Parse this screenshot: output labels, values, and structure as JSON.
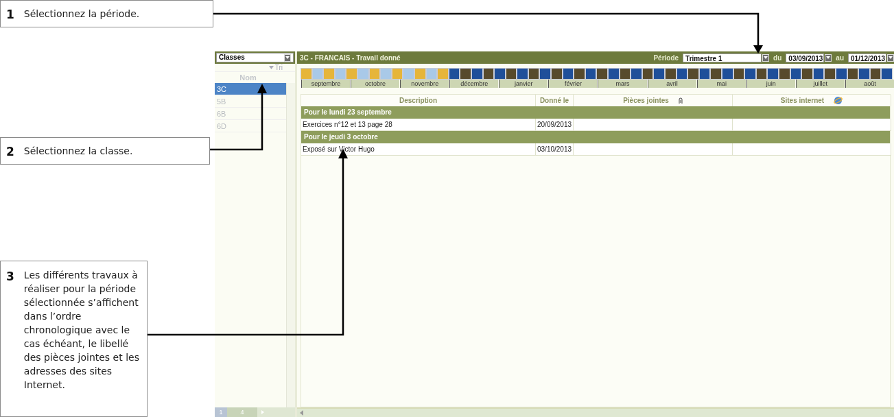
{
  "callouts": [
    {
      "number": "1",
      "text": "Sélectionnez la période."
    },
    {
      "number": "2",
      "text": "Sélectionnez la classe."
    },
    {
      "number": "3",
      "text": "Les différents travaux à réaliser pour la période sélectionnée s’affichent dans l’ordre chronologique avec le cas échéant, le libellé des pièces jointes et les adresses des sites Internet."
    }
  ],
  "sidebar": {
    "selector": "Classes",
    "sort_label": "Tri",
    "column": "Nom",
    "items": [
      {
        "label": "3C",
        "selected": true
      },
      {
        "label": "5B",
        "selected": false
      },
      {
        "label": "6B",
        "selected": false
      },
      {
        "label": "6D",
        "selected": false
      }
    ],
    "pager": {
      "current": "1",
      "total": "4"
    }
  },
  "header": {
    "title": "3C - FRANCAIS - Travail donné",
    "period_label": "Période",
    "period": "Trimestre 1",
    "from_label": "du",
    "from": "03/09/2013",
    "to_label": "au",
    "to": "01/12/2013"
  },
  "timeline": {
    "weeks": [
      {
        "color": "#e6b53a"
      },
      {
        "color": "#a9c9e8"
      },
      {
        "color": "#e6b53a"
      },
      {
        "color": "#a9c9e8"
      },
      {
        "color": "#e6b53a"
      },
      {
        "color": "#a9c9e8"
      },
      {
        "color": "#e6b53a"
      },
      {
        "color": "#a9c9e8"
      },
      {
        "color": "#e6b53a"
      },
      {
        "color": "#a9c9e8"
      },
      {
        "color": "#e6b53a"
      },
      {
        "color": "#a9c9e8"
      },
      {
        "color": "#e6b53a"
      },
      {
        "color": "#1f4f9a"
      },
      {
        "color": "#574a2c"
      },
      {
        "color": "#1f4f9a"
      },
      {
        "color": "#574a2c"
      },
      {
        "color": "#1f4f9a"
      },
      {
        "color": "#574a2c"
      },
      {
        "color": "#1f4f9a"
      },
      {
        "color": "#574a2c"
      },
      {
        "color": "#1f4f9a"
      },
      {
        "color": "#574a2c"
      },
      {
        "color": "#1f4f9a"
      },
      {
        "color": "#574a2c"
      },
      {
        "color": "#1f4f9a"
      },
      {
        "color": "#574a2c"
      },
      {
        "color": "#1f4f9a"
      },
      {
        "color": "#574a2c"
      },
      {
        "color": "#1f4f9a"
      },
      {
        "color": "#574a2c"
      },
      {
        "color": "#1f4f9a"
      },
      {
        "color": "#574a2c"
      },
      {
        "color": "#1f4f9a"
      },
      {
        "color": "#574a2c"
      },
      {
        "color": "#1f4f9a"
      },
      {
        "color": "#574a2c"
      },
      {
        "color": "#1f4f9a"
      },
      {
        "color": "#574a2c"
      },
      {
        "color": "#1f4f9a"
      },
      {
        "color": "#574a2c"
      },
      {
        "color": "#1f4f9a"
      },
      {
        "color": "#574a2c"
      },
      {
        "color": "#1f4f9a"
      },
      {
        "color": "#574a2c"
      },
      {
        "color": "#1f4f9a"
      },
      {
        "color": "#574a2c"
      },
      {
        "color": "#1f4f9a"
      },
      {
        "color": "#574a2c"
      },
      {
        "color": "#1f4f9a"
      },
      {
        "color": "#574a2c"
      },
      {
        "color": "#1f4f9a"
      }
    ],
    "months": [
      "septembre",
      "octobre",
      "novembre",
      "décembre",
      "janvier",
      "février",
      "mars",
      "avril",
      "mai",
      "juin",
      "juillet",
      "août"
    ]
  },
  "table": {
    "columns": [
      "Description",
      "Donné le",
      "Pièces jointes",
      "Sites internet"
    ],
    "groups": [
      {
        "title": "Pour le lundi 23 septembre",
        "rows": [
          {
            "description": "Exercices n°12 et 13 page 28",
            "given": "20/09/2013"
          }
        ]
      },
      {
        "title": "Pour le jeudi 3 octobre",
        "rows": [
          {
            "description": "Exposé sur Victor Hugo",
            "given": "03/10/2013"
          }
        ]
      }
    ]
  }
}
